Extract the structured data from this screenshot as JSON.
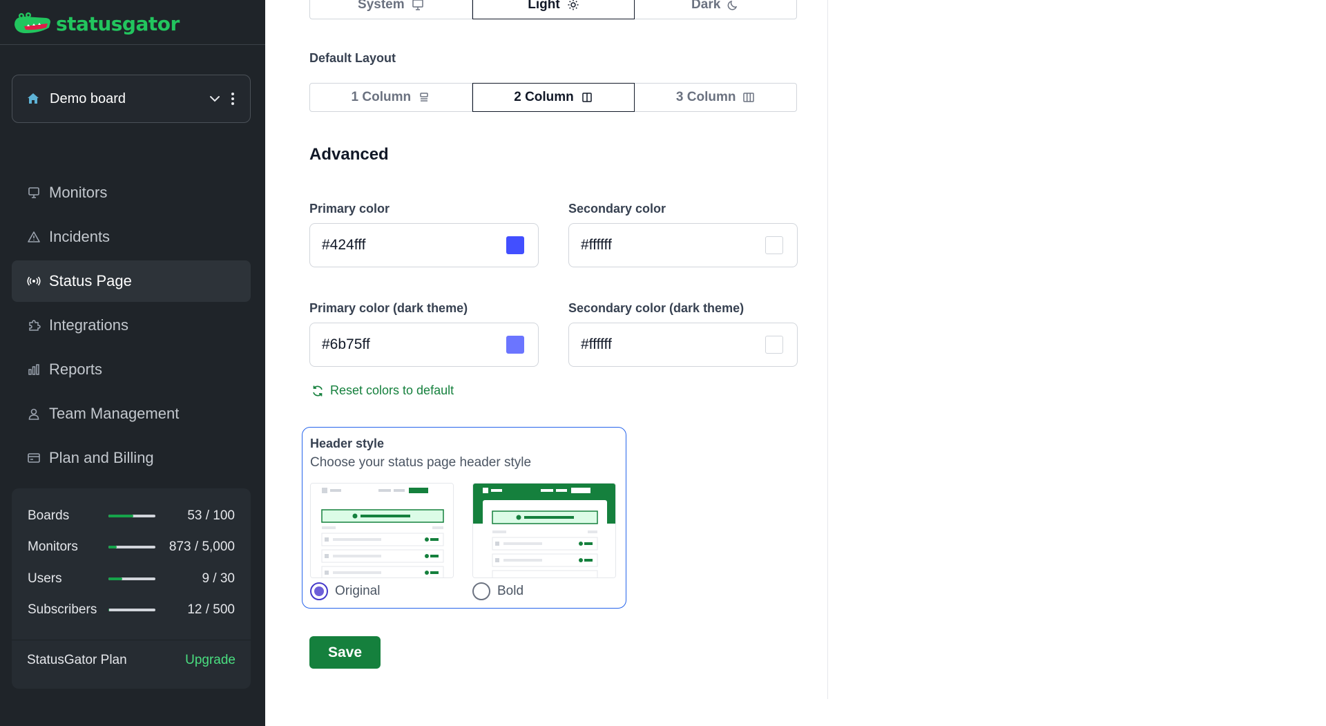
{
  "app": {
    "name": "statusgator",
    "brand_color": "#22c55e"
  },
  "board": {
    "name": "Demo board"
  },
  "nav": {
    "items": [
      {
        "label": "Monitors",
        "icon": "monitor-icon"
      },
      {
        "label": "Incidents",
        "icon": "warning-icon"
      },
      {
        "label": "Status Page",
        "icon": "broadcast-icon",
        "active": true
      },
      {
        "label": "Integrations",
        "icon": "puzzle-icon"
      },
      {
        "label": "Reports",
        "icon": "bar-chart-icon"
      },
      {
        "label": "Team Management",
        "icon": "user-icon"
      },
      {
        "label": "Plan and Billing",
        "icon": "credit-card-icon"
      }
    ]
  },
  "usage": {
    "rows": [
      {
        "label": "Boards",
        "value": "53 / 100",
        "fraction": 0.53
      },
      {
        "label": "Monitors",
        "value": "873 / 5,000",
        "fraction": 0.17
      },
      {
        "label": "Users",
        "value": "9 / 30",
        "fraction": 0.3
      },
      {
        "label": "Subscribers",
        "value": "12 / 500",
        "fraction": 0.02
      }
    ],
    "plan": "StatusGator Plan",
    "upgrade": "Upgrade"
  },
  "theme": {
    "options": [
      {
        "label": "System",
        "icon": "monitor-icon"
      },
      {
        "label": "Light",
        "icon": "sun-icon",
        "selected": true
      },
      {
        "label": "Dark",
        "icon": "moon-icon"
      }
    ]
  },
  "layout": {
    "label": "Default Layout",
    "options": [
      {
        "label": "1 Column",
        "icon": "one-column-icon"
      },
      {
        "label": "2 Column",
        "icon": "two-column-icon",
        "selected": true
      },
      {
        "label": "3 Column",
        "icon": "three-column-icon"
      }
    ]
  },
  "advanced": {
    "title": "Advanced",
    "primary": {
      "label": "Primary color",
      "value": "#424fff"
    },
    "secondary": {
      "label": "Secondary color",
      "value": "#ffffff"
    },
    "primary_dark": {
      "label": "Primary color (dark theme)",
      "value": "#6b75ff"
    },
    "secondary_dark": {
      "label": "Secondary color (dark theme)",
      "value": "#ffffff"
    },
    "reset": "Reset colors to default"
  },
  "header_style": {
    "title": "Header style",
    "subtitle": "Choose your status page header style",
    "options": [
      {
        "label": "Original",
        "checked": true
      },
      {
        "label": "Bold",
        "checked": false
      }
    ]
  },
  "save": "Save"
}
